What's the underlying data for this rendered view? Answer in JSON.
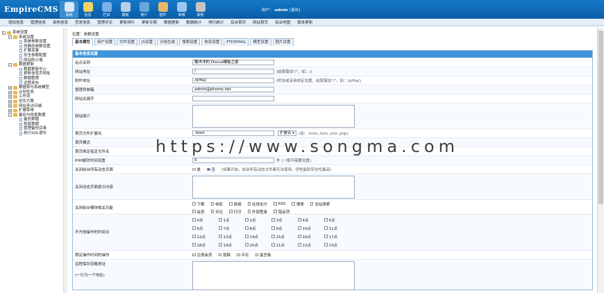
{
  "app": {
    "logo": "EmpireCMS"
  },
  "nav": [
    {
      "label": "系统",
      "color": "#dbe8f7"
    },
    {
      "label": "信息",
      "color": "#f2d46b"
    },
    {
      "label": "栏目",
      "color": "#7ab0e8"
    },
    {
      "label": "模板",
      "color": "#b8cfe6"
    },
    {
      "label": "用户",
      "color": "#6aa6e0"
    },
    {
      "label": "插件",
      "color": "#e6b86b"
    },
    {
      "label": "商城",
      "color": "#9cc6ee"
    },
    {
      "label": "其他",
      "color": "#c5c5c5"
    }
  ],
  "user": {
    "prefix": "用户：",
    "name": "admin",
    "logout": "[退出]"
  },
  "subnav": [
    "增加信息",
    "管理信息",
    "审核信息",
    "签发信息",
    "管理评论",
    "更新排片",
    "更新专题",
    "数据更新",
    "数据统计",
    "排行统计",
    "后台首页",
    "网站首页",
    "后台地图",
    "版本更新"
  ],
  "tree": [
    {
      "t": "系统设置",
      "lvl": 1,
      "ex": "-",
      "kind": "fo"
    },
    {
      "t": "系统设置",
      "lvl": 2,
      "ex": "-",
      "kind": "fo"
    },
    {
      "t": "系统参数设置",
      "lvl": 3,
      "kind": "pg"
    },
    {
      "t": "伪静态参数设置",
      "lvl": 3,
      "kind": "pg"
    },
    {
      "t": "扩展变量",
      "lvl": 3,
      "kind": "pg"
    },
    {
      "t": "安全参数配置",
      "lvl": 3,
      "kind": "pg"
    },
    {
      "t": "网站防火墙",
      "lvl": 3,
      "kind": "pg"
    },
    {
      "t": "数据更新",
      "lvl": 2,
      "ex": "-",
      "kind": "fo"
    },
    {
      "t": "数据更新中心",
      "lvl": 3,
      "kind": "pg"
    },
    {
      "t": "更新信息页地址",
      "lvl": 3,
      "kind": "pg"
    },
    {
      "t": "数据整理",
      "lvl": 3,
      "kind": "pg"
    },
    {
      "t": "远程发布",
      "lvl": 3,
      "kind": "pg"
    },
    {
      "t": "数据表与系统模型",
      "lvl": 2,
      "ex": "+",
      "kind": "fo"
    },
    {
      "t": "计划任务",
      "lvl": 2,
      "ex": "+",
      "kind": "fo"
    },
    {
      "t": "工作流",
      "lvl": 2,
      "ex": "+",
      "kind": "fo"
    },
    {
      "t": "优化方案",
      "lvl": 2,
      "ex": "+",
      "kind": "fo"
    },
    {
      "t": "网站多访问端",
      "lvl": 2,
      "ex": "+",
      "kind": "fo"
    },
    {
      "t": "扩展菜单",
      "lvl": 2,
      "ex": "+",
      "kind": "fo"
    },
    {
      "t": "备份与恢复数据",
      "lvl": 2,
      "ex": "-",
      "kind": "fo"
    },
    {
      "t": "备份数据",
      "lvl": 3,
      "kind": "pg"
    },
    {
      "t": "恢复数据",
      "lvl": 3,
      "kind": "pg"
    },
    {
      "t": "管理备份目录",
      "lvl": 3,
      "kind": "pg"
    },
    {
      "t": "执行SQL语句",
      "lvl": 3,
      "kind": "pg"
    }
  ],
  "crumb": "位置：参数设置",
  "tabs": [
    "基本属性",
    "用户设置",
    "文件设置",
    "JS设置",
    "分组生成",
    "搜索设置",
    "信息设置",
    "FTP/EMAIL",
    "模型设置",
    "图片设置"
  ],
  "form": {
    "header": "基本信息设置",
    "site_name_label": "站点名称",
    "site_name": "懒洋洋的.Discuz模板之家",
    "site_url_label": "网站地址",
    "site_url": "/",
    "site_url_hint": "(结尾需加\"/\"，如：/)",
    "attach_label": "附件地址",
    "attach_url": "/d/file/",
    "attach_hint": "(附设或采用绑定设置，结尾需加\"/\"，如：/d/file/)",
    "email_label": "管理员邮箱",
    "email": "admin@phome.net",
    "keywords_label": "网站关键字",
    "intro_label": "网站简介",
    "ext_label": "首页文件扩展名",
    "ext": ".html",
    "ext_select": "扩展名 ▾",
    "ext_hint": "(如：.html,.htm,.xml,.php)",
    "home_mode_label": "首页模式",
    "home_bind_label": "首页绑定指定文件名",
    "php_time_label": "PHP超时时间设置",
    "php_time": "0",
    "php_time_hint": "秒 (一般不需要设置)",
    "close_dyn_label": "关闭前台所有动态页面",
    "no": "是",
    "yes": "否",
    "close_dyn_hint": "(如果开启，前台所有动态文件都无法使用，但性能和安全性最高)",
    "close_tip_label": "关闭动态页面提示内容",
    "close_mod_label": "关闭前台模块相关功能",
    "modules": [
      "下载",
      "电影",
      "商城",
      "在线支付",
      "RSS",
      "搜索",
      "全站搜索",
      "会员",
      "评论",
      "打印",
      "外部登录",
      "错会项"
    ],
    "hours_label": "不开放操作的时间点",
    "hours": [
      "0点",
      "1点",
      "2点",
      "3点",
      "4点",
      "5点",
      "6点",
      "7点",
      "8点",
      "9点",
      "10点",
      "11点",
      "12点",
      "13点",
      "14点",
      "15点",
      "16点",
      "17点",
      "18点",
      "19点",
      "20点",
      "21点",
      "22点",
      "23点"
    ],
    "limit_label": "限定操作时间的操作",
    "limits": [
      "注册会员",
      "投稿",
      "评论",
      "留言板"
    ],
    "keep_label": "远程保存忽略地址",
    "keep_hint": "(一行为一个地址)"
  },
  "watermark": "https://www.songma.com"
}
